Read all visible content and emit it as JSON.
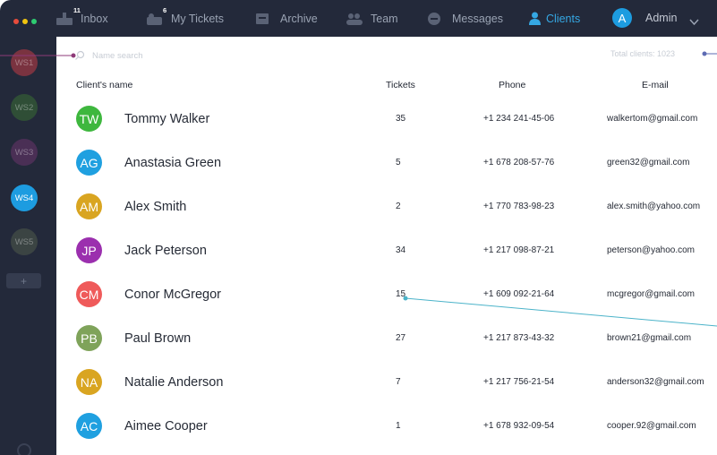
{
  "colors": {
    "chrome_bg": "#23293a",
    "accent": "#35a8e4",
    "traffic": [
      "#e74c3c",
      "#f1c40f",
      "#2ecc71"
    ]
  },
  "nav": {
    "items": [
      {
        "label": "Inbox",
        "badge": "11",
        "icon": "inbox-icon"
      },
      {
        "label": "My Tickets",
        "badge": "6",
        "icon": "tickets-icon"
      },
      {
        "label": "Archive",
        "badge": "",
        "icon": "archive-icon"
      },
      {
        "label": "Team",
        "badge": "",
        "icon": "team-icon"
      },
      {
        "label": "Messages",
        "badge": "",
        "icon": "messages-icon"
      },
      {
        "label": "Clients",
        "badge": "",
        "icon": "client-icon",
        "active": true
      }
    ],
    "user_initial": "A",
    "user_label": "Admin"
  },
  "sidebar": {
    "workspaces": [
      {
        "label": "WS1",
        "color": "#7a3340",
        "active": false
      },
      {
        "label": "WS2",
        "color": "#2f4e36",
        "active": false
      },
      {
        "label": "WS3",
        "color": "#4a2f55",
        "active": false
      },
      {
        "label": "WS4",
        "color": "#1d9ce0",
        "active": true
      },
      {
        "label": "WS5",
        "color": "#3b4443",
        "active": false
      }
    ],
    "add_label": "+"
  },
  "search": {
    "placeholder": "Name search",
    "value": ""
  },
  "summary": {
    "total_clients": "Total clients: 1023"
  },
  "table": {
    "columns": [
      "Client's name",
      "Tickets",
      "Phone",
      "E-mail"
    ],
    "rows": [
      {
        "initials": "TW",
        "color": "#3eb73e",
        "name": "Tommy Walker",
        "tickets": "35",
        "phone": "+1 234 241-45-06",
        "email": "walkertom@gmail.com"
      },
      {
        "initials": "AG",
        "color": "#1fa0e0",
        "name": "Anastasia Green",
        "tickets": "5",
        "phone": "+1 678 208-57-76",
        "email": "green32@gmail.com"
      },
      {
        "initials": "AM",
        "color": "#d9a521",
        "name": "Alex Smith",
        "tickets": "2",
        "phone": "+1 770 783-98-23",
        "email": "alex.smith@yahoo.com"
      },
      {
        "initials": "JP",
        "color": "#9b2fae",
        "name": "Jack Peterson",
        "tickets": "34",
        "phone": "+1 217 098-87-21",
        "email": "peterson@yahoo.com"
      },
      {
        "initials": "CM",
        "color": "#ef5a5a",
        "name": "Conor McGregor",
        "tickets": "15",
        "phone": "+1 609 092-21-64",
        "email": "mcgregor@gmail.com"
      },
      {
        "initials": "PB",
        "color": "#7fa35a",
        "name": "Paul Brown",
        "tickets": "27",
        "phone": "+1 217 873-43-32",
        "email": "brown21@gmail.com"
      },
      {
        "initials": "NA",
        "color": "#d9a521",
        "name": "Natalie Anderson",
        "tickets": "7",
        "phone": "+1 217 756-21-54",
        "email": "anderson32@gmail.com"
      },
      {
        "initials": "AC",
        "color": "#1fa0e0",
        "name": "Aimee Cooper",
        "tickets": "1",
        "phone": "+1 678 932-09-54",
        "email": "cooper.92@gmail.com"
      }
    ]
  }
}
